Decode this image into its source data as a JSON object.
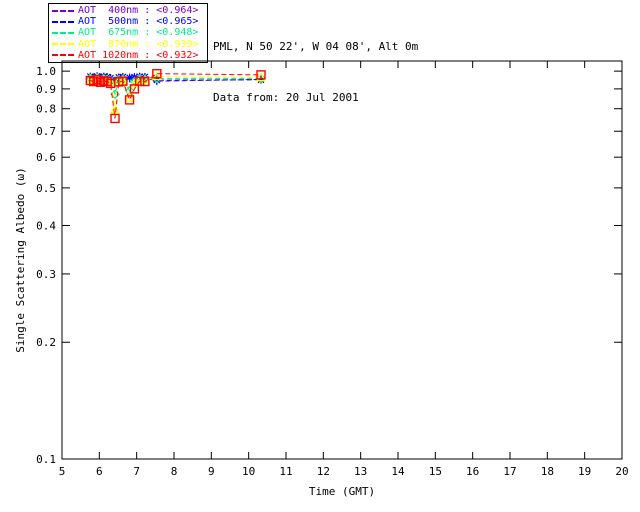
{
  "header": {
    "line1": "PML, N 50 22', W 04 08', Alt 0m",
    "line2": "Data from: 20 Jul 2001"
  },
  "chart_data": {
    "type": "line",
    "title": "",
    "xlabel": "Time (GMT)",
    "ylabel": "Single Scattering Albedo (ω)",
    "xlim": [
      5,
      20
    ],
    "ylim": [
      0.1,
      1.062
    ],
    "yscale": "log",
    "grid": false,
    "linestyle": "dashed",
    "legend_position": "top-left",
    "xticks": [
      5,
      6,
      7,
      8,
      9,
      10,
      11,
      12,
      13,
      14,
      15,
      16,
      17,
      18,
      19,
      20
    ],
    "xtick_labels": [
      "5",
      "6",
      "7",
      "8",
      "9",
      "10",
      "11",
      "12",
      "13",
      "14",
      "15",
      "16",
      "17",
      "18",
      "19",
      "20"
    ],
    "yticks": [
      1.0,
      0.9,
      0.8,
      0.7,
      0.6,
      0.5,
      0.4,
      0.3,
      0.2,
      0.1
    ],
    "ytick_labels": [
      "1.0",
      "0.9",
      "0.8",
      "0.7",
      "0.6",
      "0.5",
      "0.4",
      "0.3",
      "0.2",
      "0.1"
    ],
    "x": [
      5.76,
      5.85,
      5.94,
      6.03,
      6.12,
      6.21,
      6.3,
      6.42,
      6.52,
      6.63,
      6.81,
      6.94,
      7.08,
      7.22,
      7.54,
      10.33
    ],
    "series": [
      {
        "name": "AOT 400nm",
        "mean": "<0.964>",
        "legend_label": "AOT  400nm : <0.964>",
        "color": "#7700CC",
        "marker": "plus",
        "values": [
          0.965,
          0.96,
          0.968,
          0.958,
          0.965,
          0.962,
          0.957,
          0.938,
          0.96,
          0.963,
          0.958,
          0.962,
          0.966,
          0.963,
          0.942,
          0.952
        ]
      },
      {
        "name": "AOT 500nm",
        "mean": "<0.965>",
        "legend_label": "AOT  500nm : <0.965>",
        "color": "#0000FF",
        "marker": "asterisk",
        "values": [
          0.968,
          0.963,
          0.97,
          0.962,
          0.968,
          0.965,
          0.96,
          0.945,
          0.963,
          0.966,
          0.962,
          0.965,
          0.968,
          0.966,
          0.948,
          0.95
        ]
      },
      {
        "name": "AOT 675nm",
        "mean": "<0.948>",
        "legend_label": "AOT  675nm : <0.948>",
        "color": "#00EE88",
        "marker": "diamond",
        "values": [
          0.958,
          0.952,
          0.96,
          0.95,
          0.956,
          0.952,
          0.945,
          0.872,
          0.95,
          0.953,
          0.89,
          0.94,
          0.955,
          0.952,
          0.958,
          0.958
        ]
      },
      {
        "name": "AOT 870nm",
        "mean": "<0.939>",
        "legend_label": "AOT  870nm : <0.939>",
        "color": "#FFFF00",
        "marker": "triangle",
        "values": [
          0.952,
          0.946,
          0.955,
          0.944,
          0.95,
          0.946,
          0.938,
          0.795,
          0.944,
          0.947,
          0.852,
          0.928,
          0.948,
          0.946,
          0.968,
          0.962
        ]
      },
      {
        "name": "AOT 1020nm",
        "mean": "<0.932>",
        "legend_label": "AOT 1020nm : <0.932>",
        "color": "#FF0000",
        "marker": "square",
        "values": [
          0.946,
          0.94,
          0.95,
          0.936,
          0.944,
          0.94,
          0.93,
          0.755,
          0.938,
          0.942,
          0.843,
          0.9,
          0.942,
          0.94,
          0.985,
          0.978
        ]
      }
    ]
  }
}
